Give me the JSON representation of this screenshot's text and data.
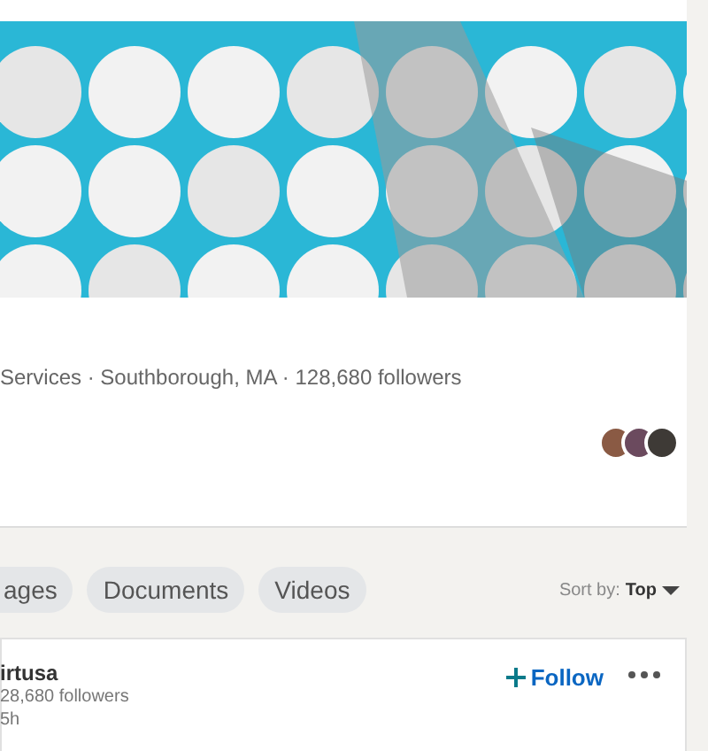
{
  "company": {
    "meta": "Services · Southborough, MA · 128,680 followers"
  },
  "filters": [
    {
      "label": "ages",
      "selected": false
    },
    {
      "label": "Documents",
      "selected": false
    },
    {
      "label": "Videos",
      "selected": false
    }
  ],
  "sort": {
    "label": "Sort by:",
    "value": "Top"
  },
  "post": {
    "author": "irtusa",
    "followers": "28,680 followers",
    "time": "5h",
    "follow": "Follow"
  }
}
